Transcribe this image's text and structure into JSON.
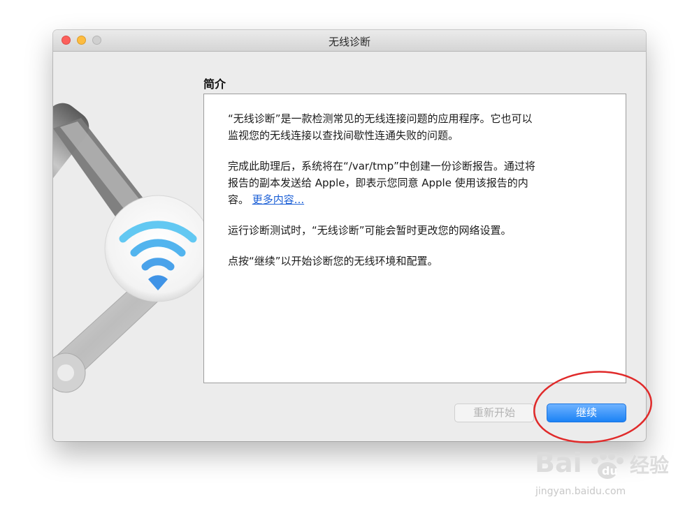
{
  "window": {
    "title": "无线诊断",
    "controls": [
      "close-icon",
      "minimize-icon",
      "zoom-icon"
    ]
  },
  "section": {
    "title": "简介"
  },
  "content": {
    "paragraph1_line1": "“无线诊断”是一款检测常见的无线连接问题的应用程序。它也可以",
    "paragraph1_line2": "监视您的无线连接以查找间歇性连通失败的问题。",
    "paragraph2_line1": "完成此助理后，系统将在“/var/tmp”中创建一份诊断报告。通过将",
    "paragraph2_line2": "报告的副本发送给 Apple，即表示您同意 Apple 使用该报告的内",
    "paragraph2_line3": "容。",
    "more_link": "更多内容...",
    "paragraph3": "运行诊断测试时，“无线诊断”可能会暂时更改您的网络设置。",
    "paragraph4": "点按“继续”以开始诊断您的无线环境和配置。"
  },
  "buttons": {
    "restart": "重新开始",
    "continue": "继续"
  },
  "colors": {
    "accent": "#1b82f5",
    "annotation": "#e02a2a"
  },
  "watermark": {
    "logo": "Bai du 经验",
    "url": "jingyan.baidu.com"
  }
}
